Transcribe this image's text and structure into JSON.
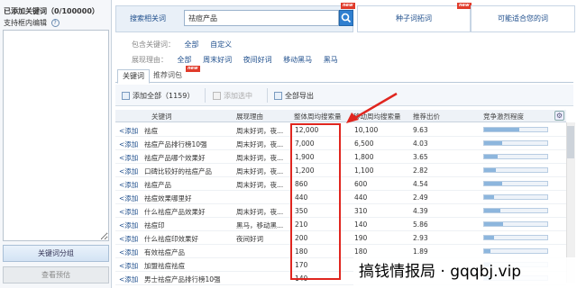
{
  "left_panel": {
    "title": "已添加关键词（0/100000）",
    "subtitle": "支持框内编辑",
    "help_icon": "?",
    "group_button": "关键词分组",
    "preview_button": "查看预估"
  },
  "search": {
    "label": "搜索相关词",
    "value": "祛痘产品",
    "new_badge": "new"
  },
  "top_tabs": {
    "seed": "种子词拓词",
    "suitable": "可能适合您的词",
    "new_badge": "new"
  },
  "filters": {
    "include_label": "包含关键词：",
    "include_all": "全部",
    "include_custom": "自定义",
    "reason_label": "展现理由：",
    "reason_options": [
      "全部",
      "周末好词",
      "夜间好词",
      "移动黑马",
      "黑马"
    ]
  },
  "subtabs": {
    "keywords": "关键词",
    "recommend": "推荐词包",
    "new_badge": "new"
  },
  "toolbar": {
    "add_all": "添加全部（1159）",
    "add_selected": "添加选中",
    "export_all": "全部导出"
  },
  "table": {
    "headers": [
      "关键词",
      "展现理由",
      "整体周均搜索量",
      "移动周均搜索量",
      "推荐出价",
      "竞争激烈程度"
    ],
    "add_label": "<添加",
    "rows": [
      {
        "keyword": "祛痘",
        "reason": "周末好词，夜...",
        "total": "12,000",
        "mobile": "10,100",
        "bid": "9.63",
        "competition": 0.55
      },
      {
        "keyword": "祛痘产品排行榜10强",
        "reason": "周末好词，夜...",
        "total": "7,000",
        "mobile": "6,500",
        "bid": "4.03",
        "competition": 0.28
      },
      {
        "keyword": "祛痘产品哪个效果好",
        "reason": "周末好词，夜...",
        "total": "1,900",
        "mobile": "1,800",
        "bid": "3.65",
        "competition": 0.22
      },
      {
        "keyword": "口碑比较好的祛痘产品",
        "reason": "周末好词，夜...",
        "total": "1,200",
        "mobile": "1,100",
        "bid": "2.82",
        "competition": 0.18
      },
      {
        "keyword": "祛痘产品",
        "reason": "周末好词，夜...",
        "total": "860",
        "mobile": "600",
        "bid": "4.54",
        "competition": 0.28
      },
      {
        "keyword": "祛痘效果哪里好",
        "reason": "",
        "total": "440",
        "mobile": "440",
        "bid": "2.49",
        "competition": 0.15
      },
      {
        "keyword": "什么祛痘产品效果好",
        "reason": "周末好词，夜...",
        "total": "350",
        "mobile": "310",
        "bid": "4.39",
        "competition": 0.25
      },
      {
        "keyword": "祛痘印",
        "reason": "黑马，移动黑...",
        "total": "210",
        "mobile": "140",
        "bid": "5.86",
        "competition": 0.3
      },
      {
        "keyword": "什么祛痘印效果好",
        "reason": "夜间好词",
        "total": "200",
        "mobile": "190",
        "bid": "2.93",
        "competition": 0.15
      },
      {
        "keyword": "有效祛痘产品",
        "reason": "",
        "total": "180",
        "mobile": "180",
        "bid": "1.89",
        "competition": 0.1
      },
      {
        "keyword": "加盟祛痘祛痘",
        "reason": "",
        "total": "170",
        "mobile": "",
        "bid": "",
        "competition": 0.1
      },
      {
        "keyword": "男士祛痘产品排行榜10强",
        "reason": "",
        "total": "140",
        "mobile": "",
        "bid": "",
        "competition": 0.1
      }
    ]
  },
  "watermark": "搞钱情报局 · gqqbj.vip",
  "colors": {
    "accent": "#1e4e8c",
    "highlight": "#e0261f",
    "badge": "#e03b2b"
  }
}
